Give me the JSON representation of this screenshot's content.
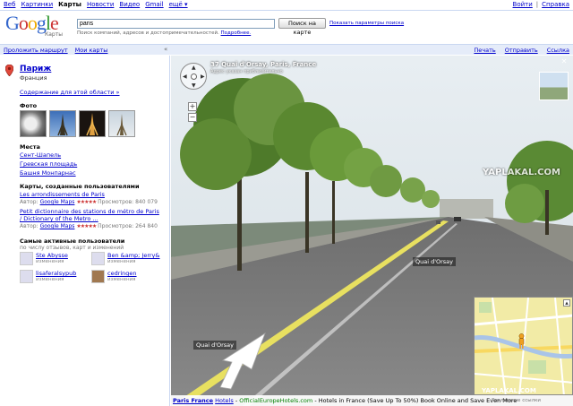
{
  "topnav": {
    "items": [
      "Веб",
      "Картинки",
      "Карты",
      "Новости",
      "Видео",
      "Gmail",
      "ещё ▾"
    ],
    "active_index": 2,
    "login": "Войти",
    "help": "Справка"
  },
  "header": {
    "logo_text": "Google",
    "logo_sub": "Карты",
    "search_value": "paris",
    "search_button": "Поиск на карте",
    "search_options": "Показать параметры поиска",
    "hint": "Поиск компаний, адресов и достопримечательностей.",
    "hint_link": "Подробнее."
  },
  "toolbar": {
    "route": "Проложить маршрут",
    "my_maps": "Мои карты",
    "print": "Печать",
    "send": "Отправить",
    "link": "Ссылка"
  },
  "sidebar": {
    "title": "Париж",
    "subtitle": "Франция",
    "area_link": "Содержание для этой области »",
    "photos_heading": "Фото",
    "places_heading": "Места",
    "places": [
      "Сент-Шапель",
      "Гревская площадь",
      "Башня Монпарнас"
    ],
    "user_maps_heading": "Карты, созданные пользователями",
    "maps": [
      {
        "title": "Les arrondissements de Paris",
        "author_label": "Автор:",
        "author": "Google Maps",
        "views": "Просмотров: 840 079"
      },
      {
        "title": "Petit dictionnaire des stations de métro de Paris / Dictionary of the Metro ...",
        "author_label": "Автор:",
        "author": "Google Maps",
        "views": "Просмотров: 264 840"
      }
    ],
    "active_users_heading": "Самые активные пользователи",
    "active_users_sub": "по числу отзывов, карт и изменений",
    "users": [
      {
        "name": "Ste Abysse",
        "role": "изменения"
      },
      {
        "name": "Ben &amp; Jerry&",
        "role": "изменения"
      },
      {
        "name": "lisaferalsypub",
        "role": "изменения"
      },
      {
        "name": "cedringen",
        "role": "изменения"
      }
    ]
  },
  "streetview": {
    "address": "37 Quai d'Orsay, Paris, France",
    "address_sub": "Адрес указан приблизительно",
    "road_label_1": "Quai d'Orsay",
    "road_label_2": "Quai d'Orsay",
    "watermark": "YAPLAKAL.COM",
    "watermark2": "YAPLAKAL.COM"
  },
  "adbar": {
    "title": "Paris France",
    "title_rest": "Hotels",
    "url": "OfficialEuropeHotels.com",
    "text": "- Hotels in France (Save Up To 50%) Book Online and Save Even More",
    "tag": "Рекламные ссылки"
  },
  "colors": {
    "link": "#0000cc",
    "toolbar_bg": "#e5ecf9",
    "road_line": "#e8e060",
    "sky": "#dfe8ee"
  }
}
